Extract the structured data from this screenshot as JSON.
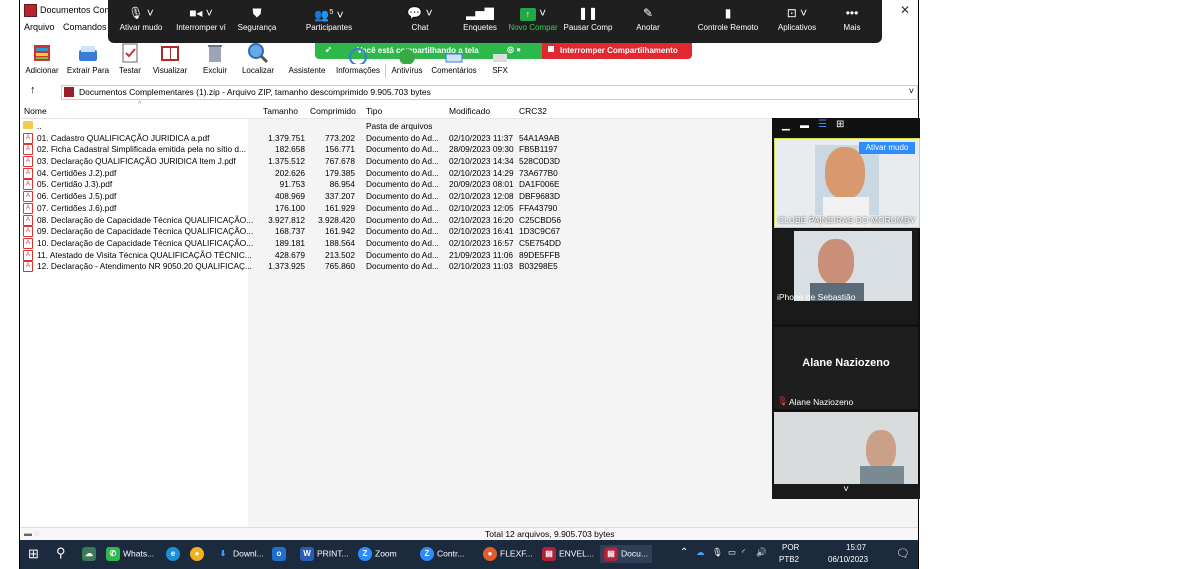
{
  "window": {
    "title": "Documentos Comp"
  },
  "menu": {
    "arquivo": "Arquivo",
    "comandos": "Comandos"
  },
  "zoom_toolbar": {
    "items": [
      {
        "label": "Ativar mudo",
        "icon": "microphone-icon"
      },
      {
        "label": "Interromper ví",
        "icon": "video-icon"
      },
      {
        "label": "Segurança",
        "icon": "shield-icon"
      },
      {
        "label": "Participantes",
        "icon": "participants-icon",
        "count": "5"
      },
      {
        "label": "Chat",
        "icon": "chat-icon"
      },
      {
        "label": "Enquetes",
        "icon": "poll-icon"
      },
      {
        "label": "Novo Compar",
        "icon": "share-screen-icon"
      },
      {
        "label": "Pausar Comp",
        "icon": "pause-icon"
      },
      {
        "label": "Anotar",
        "icon": "pen-icon"
      },
      {
        "label": "Controle Remoto",
        "icon": "mouse-icon"
      },
      {
        "label": "Aplicativos",
        "icon": "apps-icon"
      },
      {
        "label": "Mais",
        "icon": "more-icon"
      }
    ],
    "sharing_text": "Você está compartilhando a tela",
    "stop_sharing": "Interromper Compartilhamento",
    "sharing_color": "#2db84c",
    "stop_color": "#e12830"
  },
  "toolbar": {
    "buttons": [
      "Adicionar",
      "Extrair Para",
      "Testar",
      "Visualizar",
      "Excluir",
      "Localizar",
      "Assistente",
      "Informações",
      "Antivírus",
      "Comentários",
      "SFX"
    ]
  },
  "address": {
    "text": "Documentos Complementares (1).zip - Arquivo ZIP, tamanho descomprimido 9.905.703 bytes"
  },
  "columns": [
    "Nome",
    "Tamanho",
    "Comprimido",
    "Tipo",
    "Modificado",
    "CRC32"
  ],
  "files": [
    {
      "name": "..",
      "size": "",
      "packed": "",
      "type": "Pasta de arquivos",
      "modified": "",
      "crc": "",
      "folder": true
    },
    {
      "name": "01. Cadastro QUALIFICAÇÃO JURIDICA a.pdf",
      "size": "1.379.751",
      "packed": "773.202",
      "type": "Documento do Ad...",
      "modified": "02/10/2023 11:37",
      "crc": "54A1A9AB"
    },
    {
      "name": "02. Ficha Cadastral Simplificada emitida pela no sítio d...",
      "size": "182.658",
      "packed": "156.771",
      "type": "Documento do Ad...",
      "modified": "28/09/2023 09:30",
      "crc": "FB5B1197"
    },
    {
      "name": "03. Declaração QUALIFICAÇÃO JURIDICA Item J.pdf",
      "size": "1.375.512",
      "packed": "767.678",
      "type": "Documento do Ad...",
      "modified": "02/10/2023 14:34",
      "crc": "528C0D3D"
    },
    {
      "name": "04. Certidões J.2).pdf",
      "size": "202.626",
      "packed": "179.385",
      "type": "Documento do Ad...",
      "modified": "02/10/2023 14:29",
      "crc": "73A677B0"
    },
    {
      "name": "05. Certidão J.3).pdf",
      "size": "91.753",
      "packed": "86.954",
      "type": "Documento do Ad...",
      "modified": "20/09/2023 08:01",
      "crc": "DA1F006E"
    },
    {
      "name": "06. Certidões J.5).pdf",
      "size": "408.969",
      "packed": "337.207",
      "type": "Documento do Ad...",
      "modified": "02/10/2023 12:08",
      "crc": "DBF9683D"
    },
    {
      "name": "07. Certidões J.6).pdf",
      "size": "176.100",
      "packed": "161.929",
      "type": "Documento do Ad...",
      "modified": "02/10/2023 12:05",
      "crc": "FFA43790"
    },
    {
      "name": "08. Declaração de Capacidade Técnica QUALIFICAÇÃO...",
      "size": "3.927.812",
      "packed": "3.928.420",
      "type": "Documento do Ad...",
      "modified": "02/10/2023 16:20",
      "crc": "C25CBD56"
    },
    {
      "name": "09. Declaração de Capacidade Técnica QUALIFICAÇÃO...",
      "size": "168.737",
      "packed": "161.942",
      "type": "Documento do Ad...",
      "modified": "02/10/2023 16:41",
      "crc": "1D3C9C67"
    },
    {
      "name": "10. Declaração de Capacidade Técnica QUALIFICAÇÃO...",
      "size": "189.181",
      "packed": "188.564",
      "type": "Documento do Ad...",
      "modified": "02/10/2023 16:57",
      "crc": "C5E754DD"
    },
    {
      "name": "11. Atestado de Visita Técnica QUALIFICAÇÃO TÉCNIC...",
      "size": "428.679",
      "packed": "213.502",
      "type": "Documento do Ad...",
      "modified": "21/09/2023 11:06",
      "crc": "89DE5FFB"
    },
    {
      "name": "12. Declaração - Atendimento NR 9050.20 QUALIFICAÇ...",
      "size": "1.373.925",
      "packed": "765.860",
      "type": "Documento do Ad...",
      "modified": "02/10/2023 11:03",
      "crc": "B03298E5"
    }
  ],
  "status": {
    "text": "Total 12 arquivos, 9.905.703 bytes"
  },
  "gallery": {
    "tile1_name": "CLUBE PAINEIRAS DO MORUMBY",
    "unmute_button": "Ativar mudo",
    "tile2_name": "iPhone de Sebastião",
    "tile3_center": "Alane Naziozeno",
    "tile3_name": "Alane Naziozeno"
  },
  "taskbar": {
    "items": [
      "Whats...",
      "Downl...",
      "PRINT...",
      "Zoom",
      "Contr...",
      "FLEXF...",
      "ENVEL...",
      "Docu..."
    ],
    "lang_top": "POR",
    "lang_bottom": "PTB2",
    "time": "15:07",
    "date": "06/10/2023"
  }
}
